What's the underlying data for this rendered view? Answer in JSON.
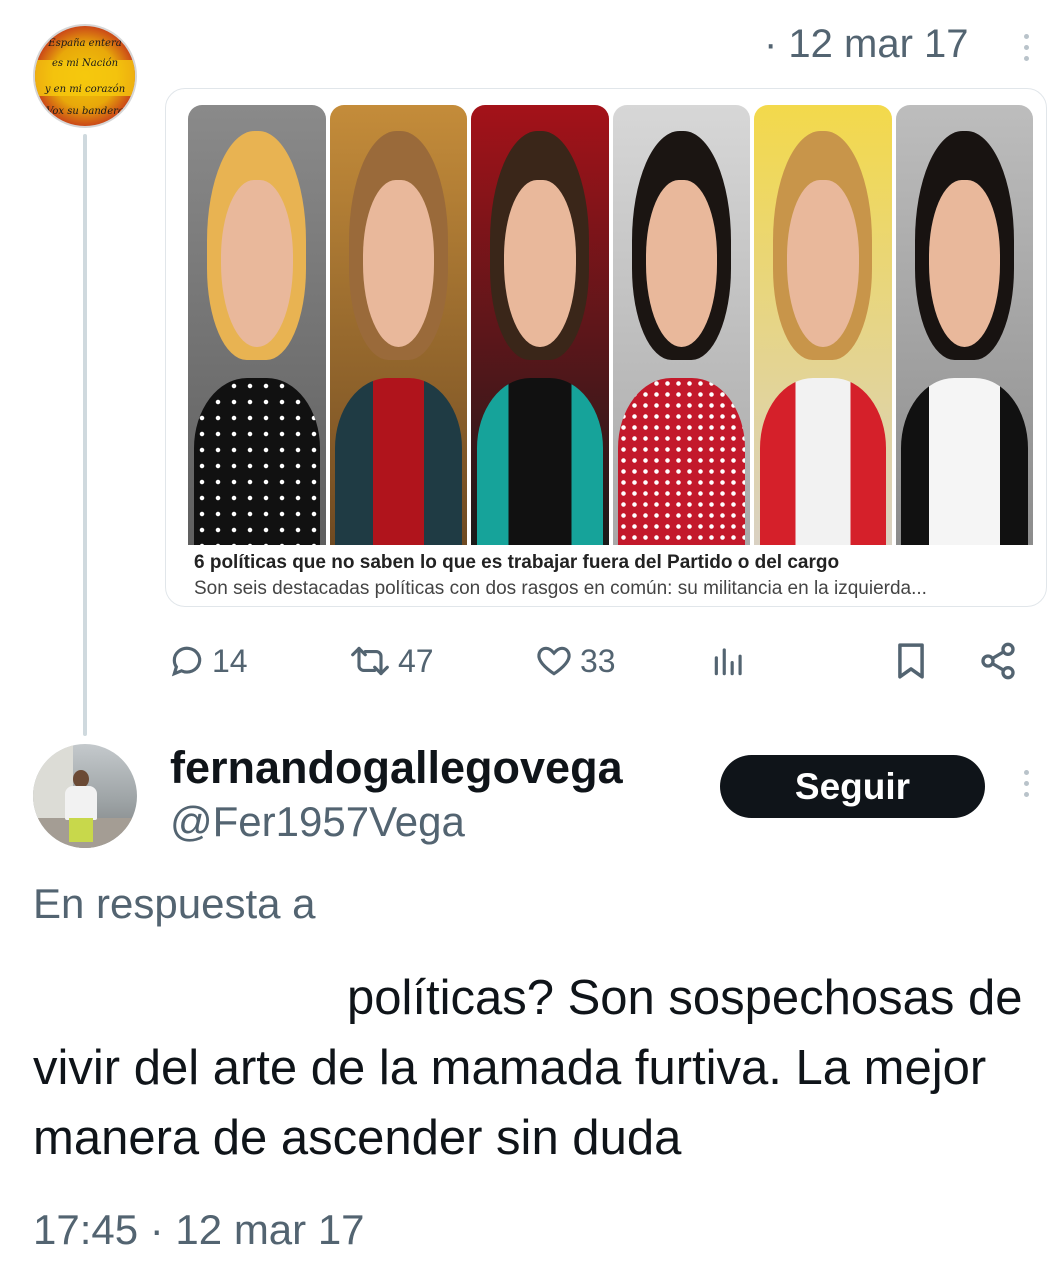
{
  "parent_tweet": {
    "avatar_text": [
      "España entera",
      "es mi Nación",
      "y en mi corazón",
      "Vox su bandera"
    ],
    "date": "· 12 mar 17",
    "link_card": {
      "title": "6 políticas que no saben lo que es trabajar fuera del Partido o del cargo",
      "description": "Son seis destacadas políticas con dos rasgos en común: su militancia en la izquierda..."
    },
    "actions": {
      "replies": "14",
      "retweets": "47",
      "likes": "33"
    }
  },
  "reply_tweet": {
    "display_name": "fernandogallegovega",
    "handle": "@Fer1957Vega",
    "follow_label": "Seguir",
    "reply_to_prefix": "En respuesta a",
    "text": "políticas? Son sospechosas de vivir del arte de la mamada furtiva. La mejor manera de ascender sin duda",
    "timestamp": "17:45 · 12 mar 17"
  },
  "icons": [
    "reply-icon",
    "retweet-icon",
    "like-icon",
    "views-icon",
    "bookmark-icon",
    "share-icon",
    "more-options-icon"
  ]
}
